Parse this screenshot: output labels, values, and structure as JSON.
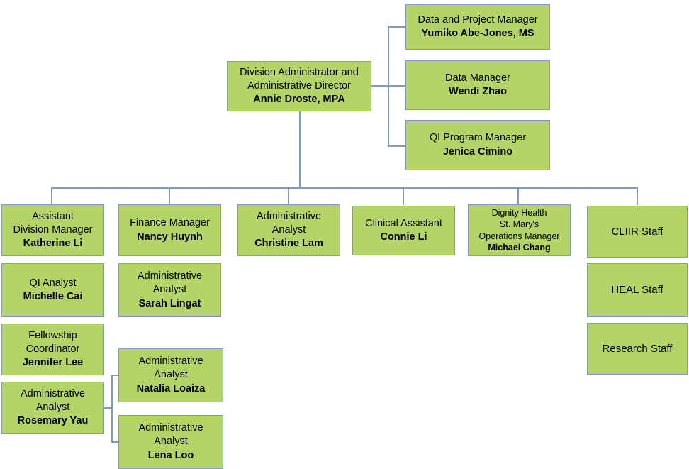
{
  "chart": {
    "kind": "organizational-chart",
    "box_fill": "#b5d468",
    "box_border": "#7f9db9",
    "connector_color": "#7f9db9",
    "background": "#ffffff"
  },
  "root": {
    "title": "Division Administrator and\nAdministrative Director",
    "person": "Annie Droste, MPA"
  },
  "direct_reports": [
    {
      "title": "Data and Project Manager",
      "person": "Yumiko Abe-Jones, MS"
    },
    {
      "title": "Data Manager",
      "person": "Wendi Zhao"
    },
    {
      "title": "QI Program Manager",
      "person": "Jenica Cimino"
    }
  ],
  "columns": [
    {
      "name": "assistant-division-manager",
      "nodes": [
        {
          "title": "Assistant\nDivision Manager",
          "person": "Katherine Li"
        },
        {
          "title": "QI Analyst",
          "person": "Michelle Cai"
        },
        {
          "title": "Fellowship\nCoordinator",
          "person": "Jennifer Lee"
        },
        {
          "title": "Administrative\nAnalyst",
          "person": "Rosemary Yau"
        }
      ]
    },
    {
      "name": "finance-manager",
      "nodes": [
        {
          "title": "Finance Manager",
          "person": "Nancy Huynh"
        },
        {
          "title": "Administrative\nAnalyst",
          "person": "Sarah Lingat"
        },
        {
          "title": "Administrative\nAnalyst",
          "person": "Natalia Loaiza"
        },
        {
          "title": "Administrative\nAnalyst",
          "person": "Lena Loo"
        }
      ]
    },
    {
      "name": "administrative-analyst",
      "nodes": [
        {
          "title": "Administrative\nAnalyst",
          "person": "Christine Lam"
        }
      ]
    },
    {
      "name": "clinical-assistant",
      "nodes": [
        {
          "title": "Clinical Assistant",
          "person": "Connie Li"
        }
      ]
    },
    {
      "name": "operations-manager",
      "nodes": [
        {
          "title": "Dignity Health\nSt. Mary's\nOperations Manager",
          "person": "Michael Chang"
        }
      ]
    },
    {
      "name": "staff-groups",
      "nodes": [
        {
          "title": "CLIIR Staff",
          "person": ""
        },
        {
          "title": "HEAL Staff",
          "person": ""
        },
        {
          "title": "Research Staff",
          "person": ""
        }
      ]
    }
  ]
}
